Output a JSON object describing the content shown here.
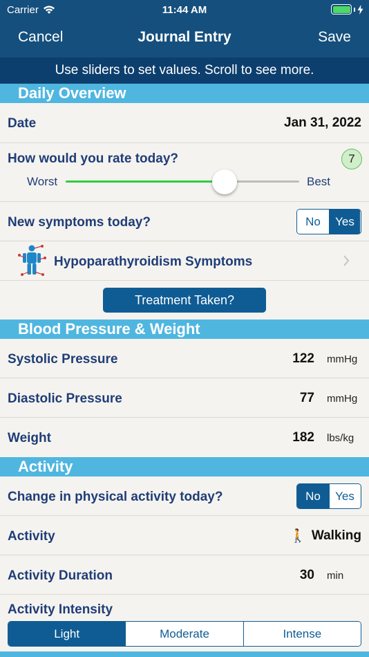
{
  "status_bar": {
    "carrier": "Carrier",
    "time": "11:44 AM"
  },
  "nav": {
    "cancel": "Cancel",
    "title": "Journal Entry",
    "save": "Save"
  },
  "hint": "Use sliders to set values. Scroll to see more.",
  "sections": {
    "daily_overview": "Daily Overview",
    "blood_pressure": "Blood Pressure & Weight",
    "activity": "Activity"
  },
  "daily": {
    "date_label": "Date",
    "date_value": "Jan 31, 2022",
    "rating_label": "How would you rate today?",
    "rating_value": "7",
    "rating_fraction": 0.68,
    "rating_min_label": "Worst",
    "rating_max_label": "Best",
    "symptoms_label": "New symptoms today?",
    "symptoms_no": "No",
    "symptoms_yes": "Yes",
    "symptoms_link": "Hypoparathyroidism Symptoms",
    "treatment_button": "Treatment Taken?"
  },
  "bp": {
    "systolic_label": "Systolic Pressure",
    "systolic_value": "122",
    "systolic_unit": "mmHg",
    "diastolic_label": "Diastolic Pressure",
    "diastolic_value": "77",
    "diastolic_unit": "mmHg",
    "weight_label": "Weight",
    "weight_value": "182",
    "weight_unit": "lbs/kg"
  },
  "activity": {
    "change_label": "Change in physical activity today?",
    "change_no": "No",
    "change_yes": "Yes",
    "activity_label": "Activity",
    "activity_value": "Walking",
    "activity_icon": "🚶",
    "duration_label": "Activity Duration",
    "duration_value": "30",
    "duration_unit": "min",
    "intensity_label": "Activity Intensity",
    "intensity_options": [
      "Light",
      "Moderate",
      "Intense"
    ]
  },
  "colors": {
    "nav": "#154f7d",
    "hint": "#0d3f6e",
    "section": "#4fb6e0",
    "accent": "#0f5c94",
    "slider": "#2ecc40"
  }
}
